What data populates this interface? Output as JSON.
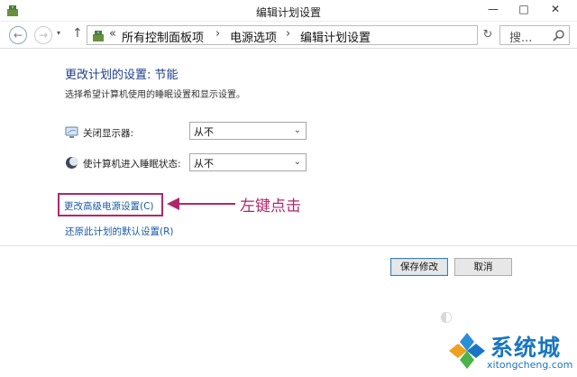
{
  "window": {
    "title": "编辑计划设置",
    "minimize": "—",
    "maximize": "□",
    "close": "✕"
  },
  "nav": {
    "back": "←",
    "forward": "→",
    "dropdown": "▾",
    "up": "↑",
    "refresh": "↻"
  },
  "breadcrumb": {
    "root_sep": "«",
    "items": [
      "所有控制面板项",
      "电源选项",
      "编辑计划设置"
    ],
    "sep": "›"
  },
  "search": {
    "placeholder": "搜..."
  },
  "main": {
    "heading": "更改计划的设置: 节能",
    "subtext": "选择希望计算机使用的睡眠设置和显示设置。",
    "display_label": "关闭显示器:",
    "display_value": "从不",
    "sleep_label": "使计算机进入睡眠状态:",
    "sleep_value": "从不",
    "advanced_link": "更改高级电源设置(C)",
    "restore_link": "还原此计划的默认设置(R)",
    "annotation": "左键点击",
    "save_button": "保存修改",
    "cancel_button": "取消"
  },
  "watermark": {
    "brand": "系统城",
    "url": "xitongcheng.com"
  },
  "colors": {
    "heading": "#1e3d8f",
    "link": "#1a5aa8",
    "annotation": "#b0286a",
    "watermark": "#1a76c2"
  }
}
